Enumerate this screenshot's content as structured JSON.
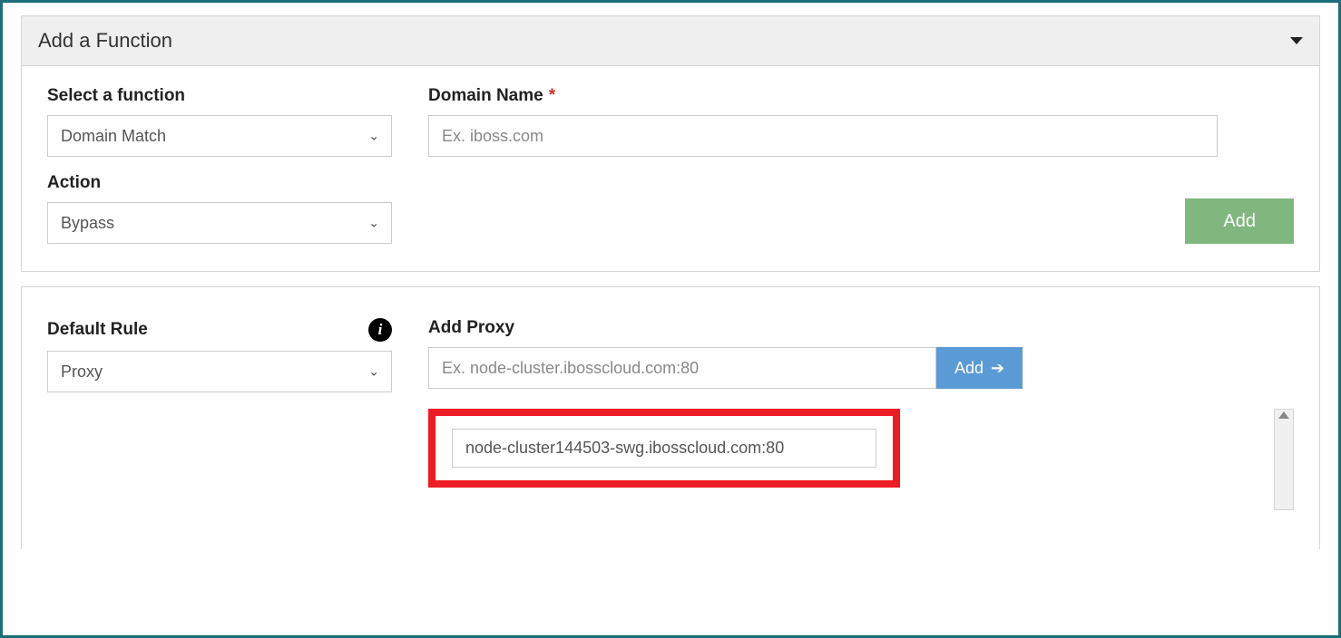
{
  "panel1": {
    "title": "Add a Function",
    "selectFunction": {
      "label": "Select a function",
      "value": "Domain Match"
    },
    "domainName": {
      "label": "Domain Name",
      "placeholder": "Ex. iboss.com"
    },
    "action": {
      "label": "Action",
      "value": "Bypass"
    },
    "addButton": "Add"
  },
  "panel2": {
    "defaultRule": {
      "label": "Default Rule",
      "value": "Proxy"
    },
    "addProxy": {
      "label": "Add Proxy",
      "placeholder": "Ex. node-cluster.ibosscloud.com:80",
      "addButton": "Add"
    },
    "proxyList": [
      "node-cluster144503-swg.ibosscloud.com:80"
    ]
  }
}
